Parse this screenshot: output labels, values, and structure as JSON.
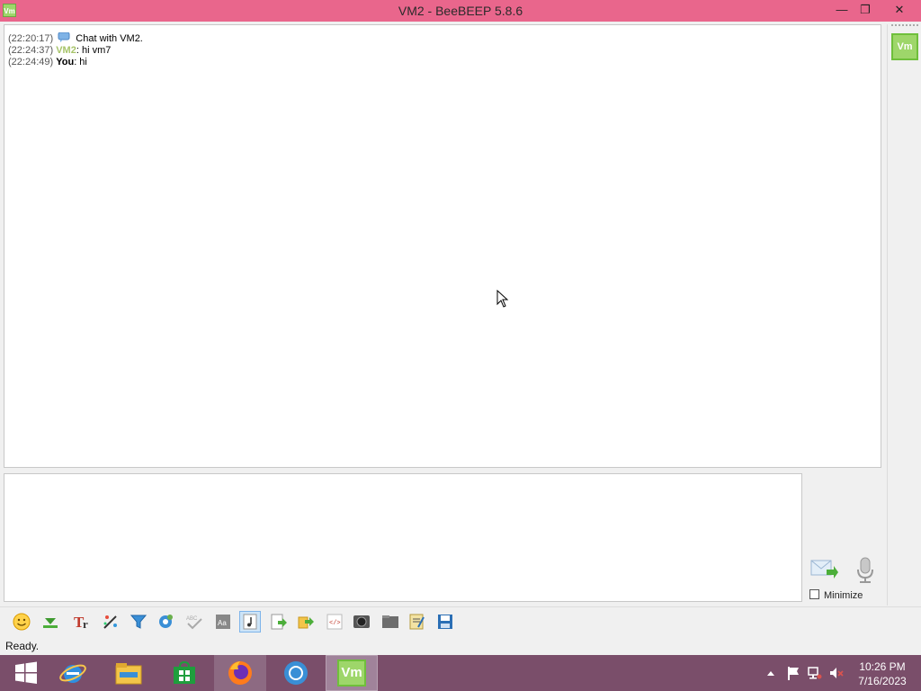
{
  "window": {
    "icon_label": "Vm",
    "title": "VM2 - BeeBEEP 5.8.6",
    "minimize_glyph": "—",
    "maximize_glyph": "❐",
    "close_glyph": "✕"
  },
  "chat": {
    "messages": [
      {
        "time": "(22:20:17)",
        "sender": "",
        "text": "Chat with VM2."
      },
      {
        "time": "(22:24:37)",
        "sender": "VM2",
        "text": ": hi vm7"
      },
      {
        "time": "(22:24:49)",
        "sender": "You",
        "text": ": hi"
      }
    ]
  },
  "userlist": {
    "user_label": "Vm"
  },
  "input": {
    "value": "",
    "minimize_label": "Minimize",
    "minimize_checked": false
  },
  "toolbar": {
    "icons": [
      "emoticon-icon",
      "insert-icon",
      "font-icon",
      "color-icon",
      "filter-icon",
      "settings-icon",
      "spellcheck-icon",
      "font-size-icon",
      "music-icon",
      "send-file-icon",
      "forward-icon",
      "html-icon",
      "screenshot-icon",
      "folder-icon",
      "clipboard-icon",
      "save-icon"
    ],
    "active_icon": "music-icon"
  },
  "status": {
    "text": "Ready."
  },
  "taskbar": {
    "apps": [
      "windows-start-icon",
      "internet-explorer-icon",
      "file-explorer-icon",
      "store-icon",
      "firefox-icon",
      "chrome-icon",
      "beebeep-icon"
    ],
    "beebeep_label": "Vm",
    "time": "10:26 PM",
    "date": "7/16/2023"
  },
  "colors": {
    "titlebar": "#e9668c",
    "taskbar": "#7a4e6a",
    "vm_green": "#9ed66a"
  }
}
